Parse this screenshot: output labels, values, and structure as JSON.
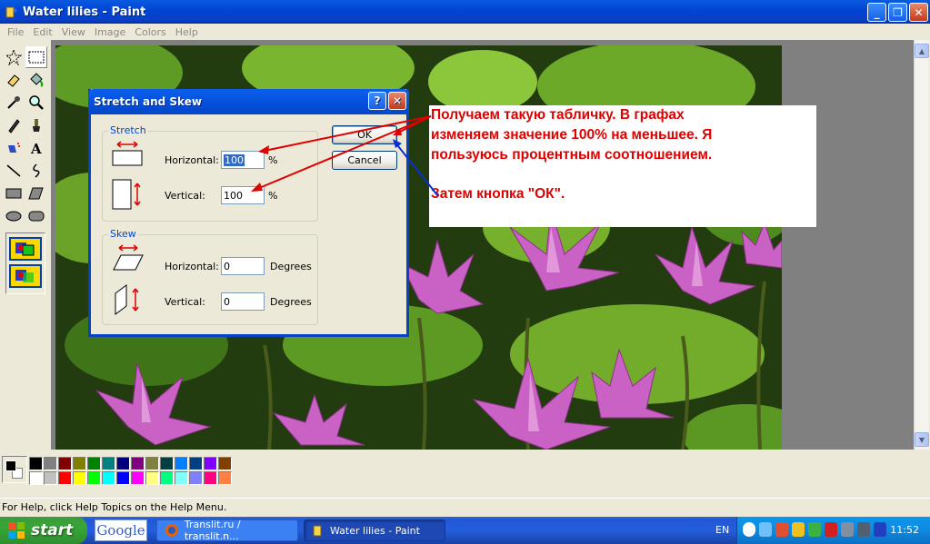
{
  "window": {
    "title": "Water lilies - Paint",
    "minimize": "_",
    "maximize": "❐",
    "close": "✕"
  },
  "menu": [
    "File",
    "Edit",
    "View",
    "Image",
    "Colors",
    "Help"
  ],
  "dialog": {
    "title": "Stretch and Skew",
    "help": "?",
    "close": "✕",
    "stretch_legend": "Stretch",
    "skew_legend": "Skew",
    "stretch_h_label": "Horizontal:",
    "stretch_h_value": "100",
    "stretch_h_unit": "%",
    "stretch_v_label": "Vertical:",
    "stretch_v_value": "100",
    "stretch_v_unit": "%",
    "skew_h_label": "Horizontal:",
    "skew_h_value": "0",
    "skew_h_unit": "Degrees",
    "skew_v_label": "Vertical:",
    "skew_v_value": "0",
    "skew_v_unit": "Degrees",
    "ok": "OK",
    "cancel": "Cancel"
  },
  "annotation": {
    "line1": "Получаем такую табличку. В графах",
    "line2": "изменяем значение 100% на меньшее. Я",
    "line3": "пользуюсь процентным  соотношением.",
    "line4": "Затем кнопка \"ОК\".",
    "color": "#e00000"
  },
  "palette": {
    "colors": [
      "#000000",
      "#808080",
      "#800000",
      "#808000",
      "#008000",
      "#008080",
      "#000080",
      "#800080",
      "#808040",
      "#004040",
      "#0080ff",
      "#004080",
      "#8000ff",
      "#804000",
      "#ffffff",
      "#c0c0c0",
      "#ff0000",
      "#ffff00",
      "#00ff00",
      "#00ffff",
      "#0000ff",
      "#ff00ff",
      "#ffff80",
      "#00ff80",
      "#80ffff",
      "#8080ff",
      "#ff0080",
      "#ff8040"
    ]
  },
  "status": "For Help, click Help Topics on the Help Menu.",
  "taskbar": {
    "start": "start",
    "google": "Google",
    "task1": "Translit.ru / translit.n...",
    "task2": "Water lilies - Paint",
    "lang": "EN",
    "clock": "11:52"
  }
}
